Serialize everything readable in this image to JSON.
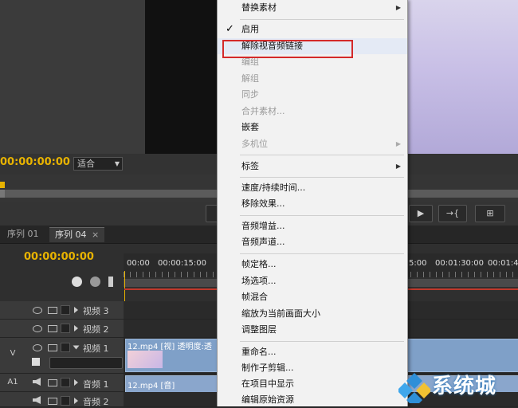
{
  "monitor": {
    "timecode": "00:00:00:00",
    "fit_label": "适合"
  },
  "transport": {
    "btn1": "▶",
    "btn2": "→{",
    "btn3": "⊞"
  },
  "timeline": {
    "tabs": [
      "序列 01",
      "序列 04"
    ],
    "tab_close": "×",
    "timecode": "00:00:00:00",
    "ruler": [
      "00:00",
      "00:00:15:00",
      "5:00",
      "00:01:30:00",
      "00:01:4"
    ],
    "tracks": [
      {
        "label": "视频 3"
      },
      {
        "label": "视频 2"
      },
      {
        "label": "视频 1",
        "side": "V"
      },
      {
        "label": "音频 1",
        "side": "A1"
      },
      {
        "label": "音频 2"
      }
    ],
    "clip_video": "12.mp4 [视] 透明度:透",
    "clip_audio": "12.mp4 [音]"
  },
  "menu": {
    "items": [
      {
        "label": "替换素材",
        "submenu": true
      },
      {
        "label": "启用",
        "checked": true
      },
      {
        "label": "解除视音频链接",
        "highlighted": true
      },
      {
        "label": "编组",
        "disabled": true
      },
      {
        "label": "解组",
        "disabled": true
      },
      {
        "label": "同步",
        "disabled": true
      },
      {
        "label": "合并素材...",
        "disabled": true
      },
      {
        "label": "嵌套"
      },
      {
        "label": "多机位",
        "disabled": true,
        "submenu": true
      },
      {
        "label": "标签",
        "submenu": true
      },
      {
        "label": "速度/持续时间..."
      },
      {
        "label": "移除效果..."
      },
      {
        "label": "音频增益..."
      },
      {
        "label": "音频声道..."
      },
      {
        "label": "帧定格..."
      },
      {
        "label": "场选项..."
      },
      {
        "label": "帧混合"
      },
      {
        "label": "缩放为当前画面大小"
      },
      {
        "label": "调整图层"
      },
      {
        "label": "重命名..."
      },
      {
        "label": "制作子剪辑..."
      },
      {
        "label": "在项目中显示"
      },
      {
        "label": "编辑原始资源"
      }
    ],
    "submenu_arrow": "▶",
    "check_glyph": "✓"
  },
  "watermark": {
    "text": "系统城"
  }
}
